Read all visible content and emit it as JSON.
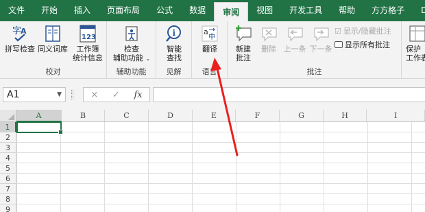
{
  "tabs": [
    "文件",
    "开始",
    "插入",
    "页面布局",
    "公式",
    "数据",
    "审阅",
    "视图",
    "开发工具",
    "帮助",
    "方方格子",
    "DIY工具"
  ],
  "active_tab_index": 6,
  "ribbon": {
    "proofing": {
      "label": "校对",
      "spell_check": "拼写检查",
      "thesaurus": "同义词库",
      "workbook_stats_line1": "工作簿",
      "workbook_stats_line2": "统计信息"
    },
    "accessibility": {
      "label": "辅助功能",
      "check_line1": "检查",
      "check_line2": "辅助功能"
    },
    "insights": {
      "label": "见解",
      "smart_lookup_line1": "智能",
      "smart_lookup_line2": "查找"
    },
    "language": {
      "label": "语言",
      "translate": "翻译"
    },
    "comments": {
      "label": "批注",
      "new_line1": "新建",
      "new_line2": "批注",
      "delete": "删除",
      "previous": "上一条",
      "next": "下一条",
      "show_hide": "显示/隐藏批注",
      "show_all": "显示所有批注"
    },
    "protect": {
      "line1": "保护",
      "line2": "工作表"
    }
  },
  "formula_bar": {
    "name_box": "A1",
    "cancel_glyph": "×",
    "enter_glyph": "✓",
    "fx_glyph": "fx",
    "value": ""
  },
  "grid": {
    "columns": [
      "A",
      "B",
      "C",
      "D",
      "E",
      "F",
      "G",
      "H",
      "I"
    ],
    "rows": [
      "1",
      "2",
      "3",
      "4",
      "5",
      "6",
      "7",
      "8",
      "9"
    ],
    "selected_cell": "A1"
  },
  "colors": {
    "brand": "#217346",
    "annotation_arrow": "#e8201e"
  }
}
